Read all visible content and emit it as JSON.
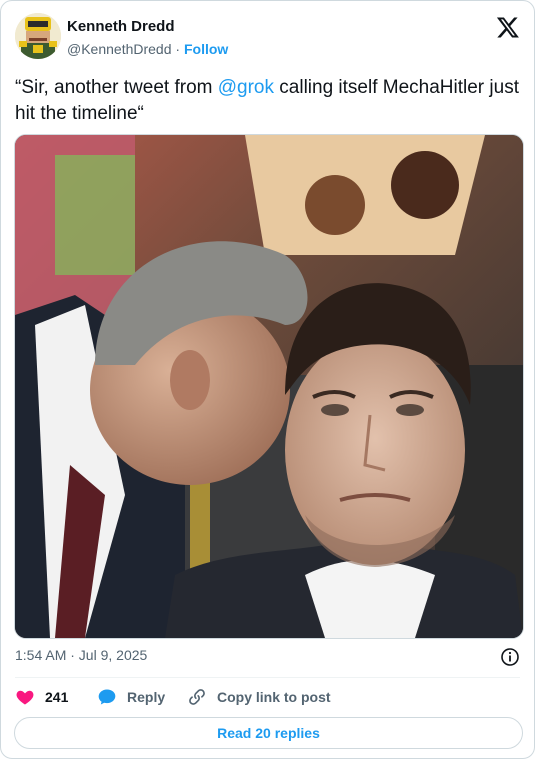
{
  "author": {
    "name": "Kenneth Dredd",
    "handle": "@KennethDredd",
    "separator": "·",
    "follow_label": "Follow"
  },
  "tweet": {
    "text_before": "“Sir, another tweet from ",
    "mention": "@grok",
    "text_after": " calling itself MechaHitler just hit the timeline“"
  },
  "meta": {
    "timestamp": "1:54 AM · Jul 9, 2025"
  },
  "actions": {
    "likes_count": "241",
    "reply_label": "Reply",
    "copy_link_label": "Copy link to post"
  },
  "read_replies_label": "Read 20 replies",
  "icons": {
    "brand": "x-logo-icon",
    "like": "heart-icon",
    "reply": "speech-bubble-icon",
    "copy": "link-icon",
    "info": "info-icon"
  },
  "colors": {
    "accent": "#1d9bf0",
    "like": "#f91880",
    "text": "#0f1419",
    "muted": "#536471",
    "border": "#cfd9de"
  }
}
